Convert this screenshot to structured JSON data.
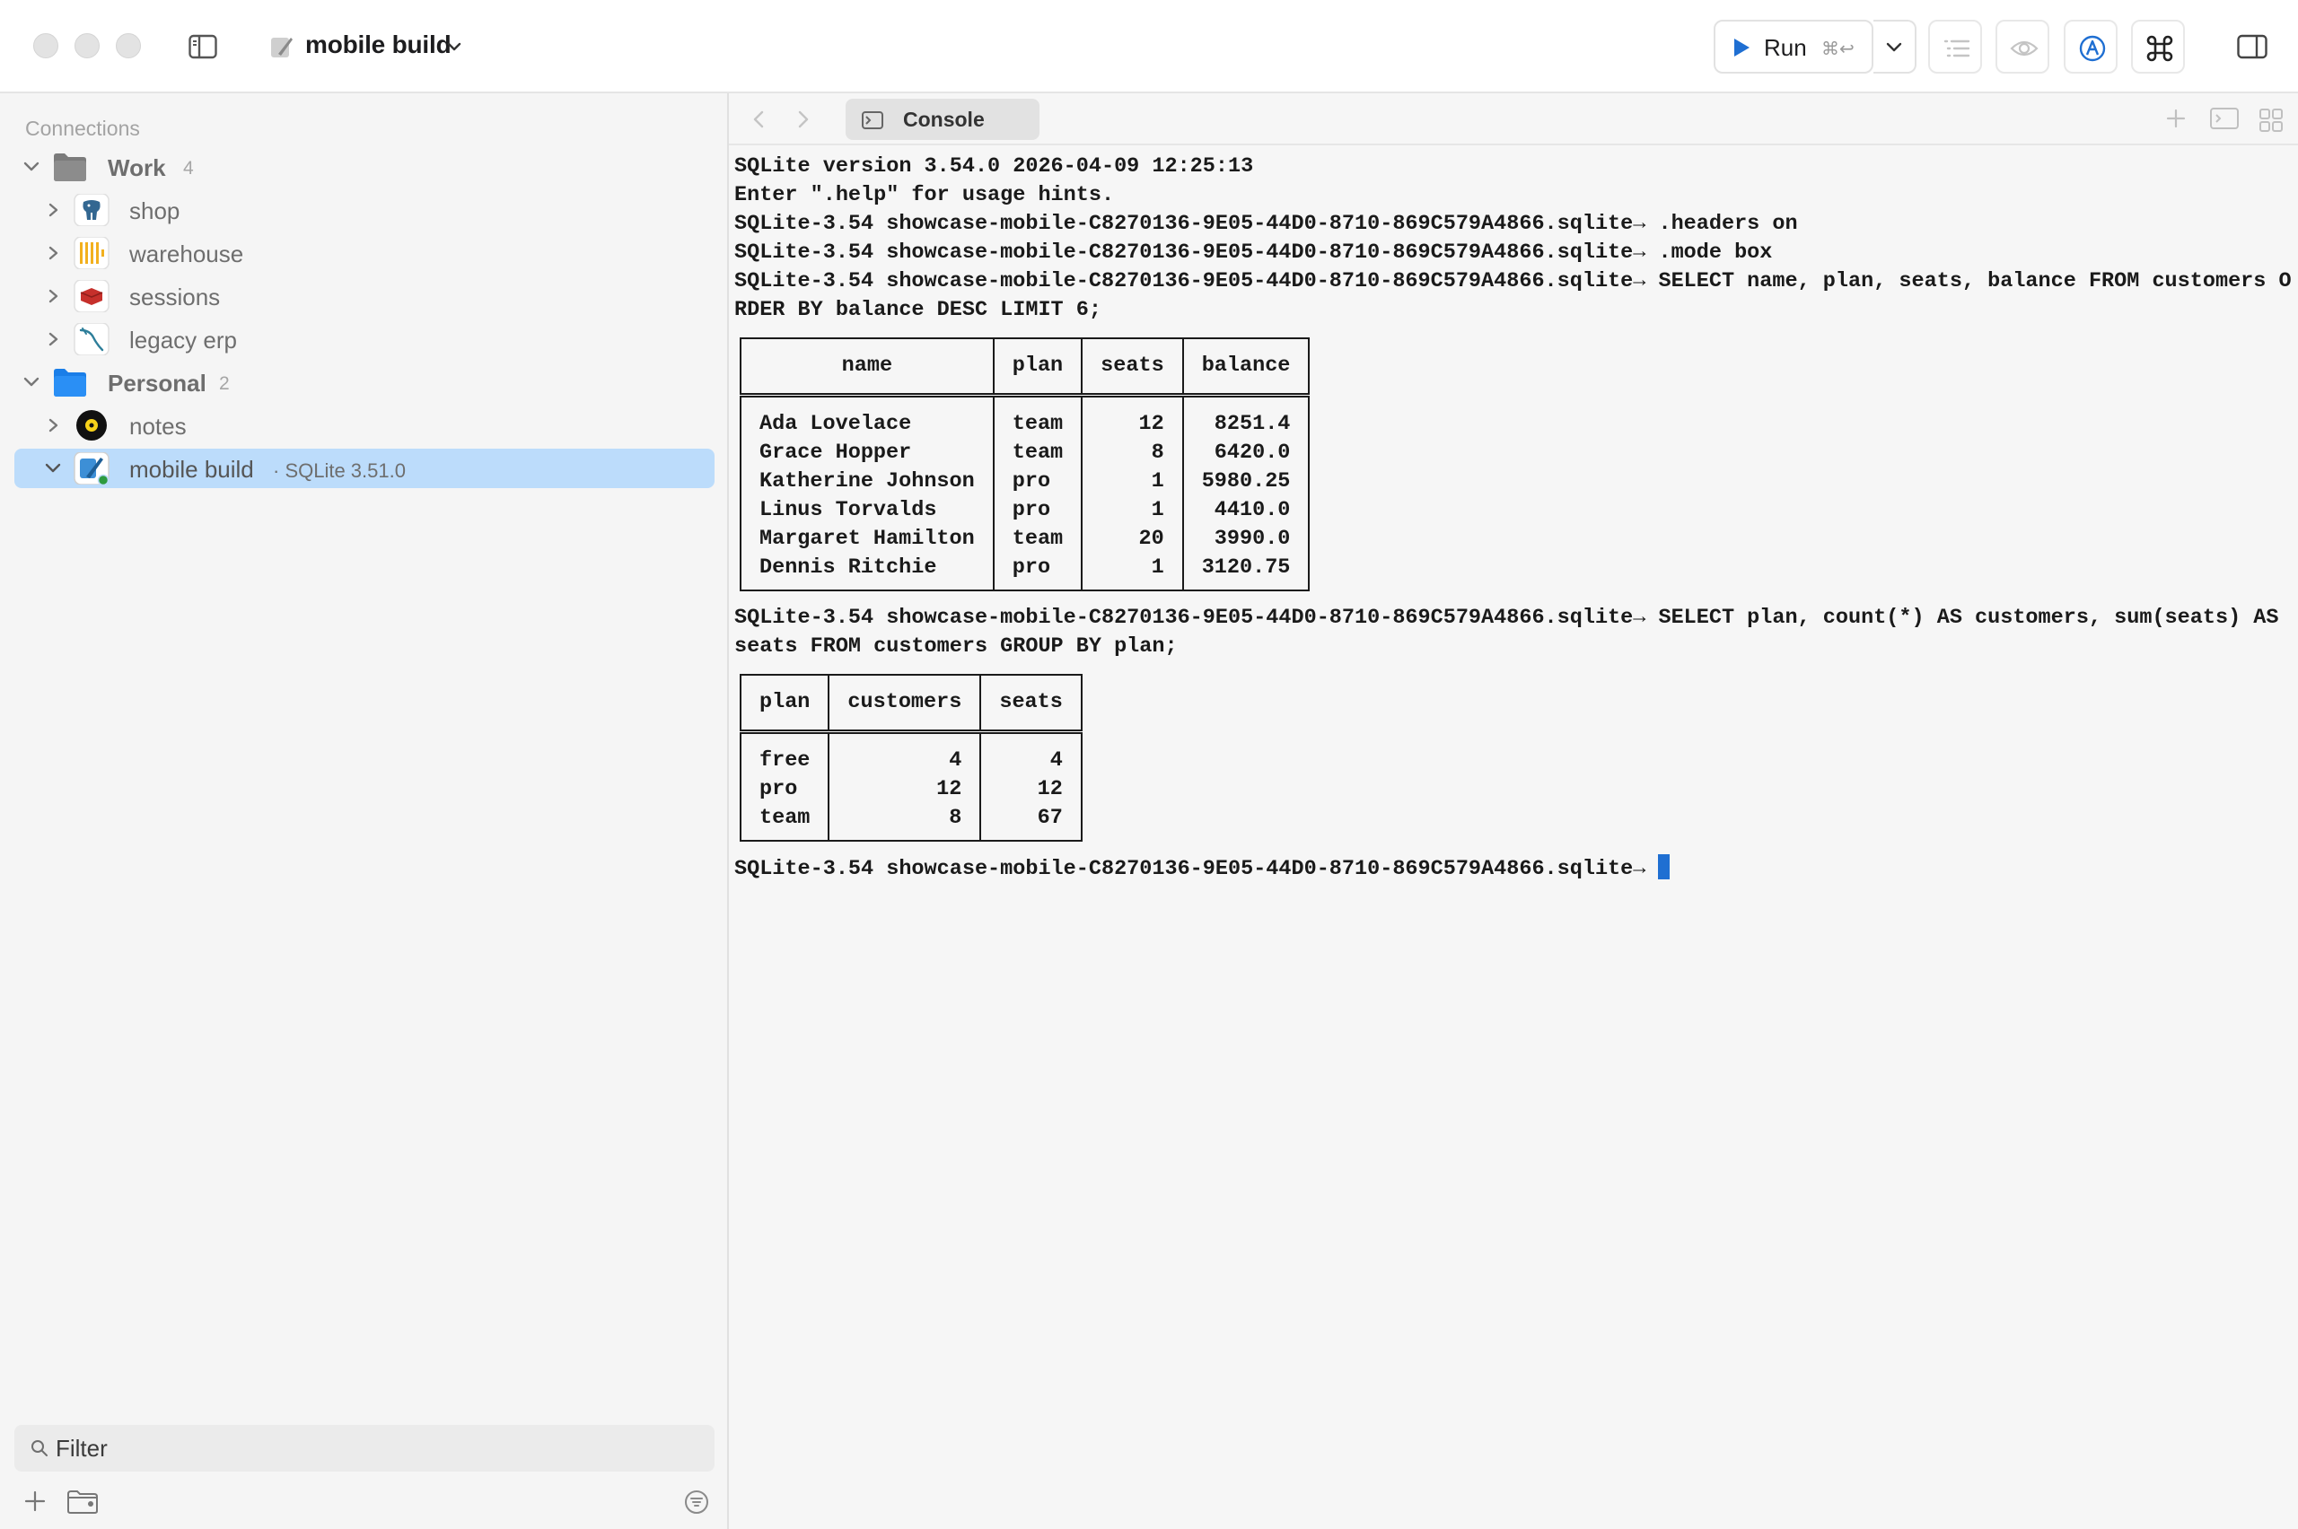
{
  "window": {
    "project_title": "mobile build",
    "run_label": "Run",
    "run_shortcut": "⌘↩"
  },
  "sidebar": {
    "section_label": "Connections",
    "groups": [
      {
        "label": "Work",
        "count": "4",
        "icon": "folder-gray-icon"
      },
      {
        "label": "Personal",
        "count": "2",
        "icon": "folder-blue-icon"
      }
    ],
    "items": [
      {
        "label": "shop",
        "icon": "postgres-elephant-icon"
      },
      {
        "label": "warehouse",
        "icon": "clickhouse-bars-icon"
      },
      {
        "label": "sessions",
        "icon": "redis-cube-icon"
      },
      {
        "label": "legacy erp",
        "icon": "mysql-dolphin-icon"
      },
      {
        "label": "notes",
        "icon": "notes-disc-icon"
      },
      {
        "label": "mobile build",
        "icon": "sqlite-feather-icon",
        "subtitle": "· SQLite 3.51.0",
        "status_color": "#2e9b3f",
        "selected": true
      }
    ],
    "filter_placeholder": "Filter"
  },
  "tabs": [
    {
      "label": "Console",
      "icon": "terminal-icon",
      "active": true
    }
  ],
  "console": {
    "lines_intro": [
      "SQLite version 3.54.0 2026-04-09 12:25:13",
      "Enter \".help\" for usage hints.",
      "SQLite-3.54 showcase-mobile-C8270136-9E05-44D0-8710-869C579A4866.sqlite→ .headers on",
      "SQLite-3.54 showcase-mobile-C8270136-9E05-44D0-8710-869C579A4866.sqlite→ .mode box",
      "SQLite-3.54 showcase-mobile-C8270136-9E05-44D0-8710-869C579A4866.sqlite→ SELECT name, plan, seats, balance FROM customers O",
      "RDER BY balance DESC LIMIT 6;"
    ],
    "table1": {
      "headers": [
        "name",
        "plan",
        "seats",
        "balance"
      ],
      "rows": [
        [
          "Ada Lovelace",
          "team",
          "12",
          "8251.4"
        ],
        [
          "Grace Hopper",
          "team",
          "8",
          "6420.0"
        ],
        [
          "Katherine Johnson",
          "pro",
          "1",
          "5980.25"
        ],
        [
          "Linus Torvalds",
          "pro",
          "1",
          "4410.0"
        ],
        [
          "Margaret Hamilton",
          "team",
          "20",
          "3990.0"
        ],
        [
          "Dennis Ritchie",
          "pro",
          "1",
          "3120.75"
        ]
      ]
    },
    "lines_mid": [
      "SQLite-3.54 showcase-mobile-C8270136-9E05-44D0-8710-869C579A4866.sqlite→ SELECT plan, count(*) AS customers, sum(seats) AS",
      "seats FROM customers GROUP BY plan;"
    ],
    "table2": {
      "headers": [
        "plan",
        "customers",
        "seats"
      ],
      "rows": [
        [
          "free",
          "4",
          "4"
        ],
        [
          "pro",
          "12",
          "12"
        ],
        [
          "team",
          "8",
          "67"
        ]
      ]
    },
    "prompt": "SQLite-3.54 showcase-mobile-C8270136-9E05-44D0-8710-869C579A4866.sqlite→ ",
    "accent_color": "#1f6fd2"
  }
}
